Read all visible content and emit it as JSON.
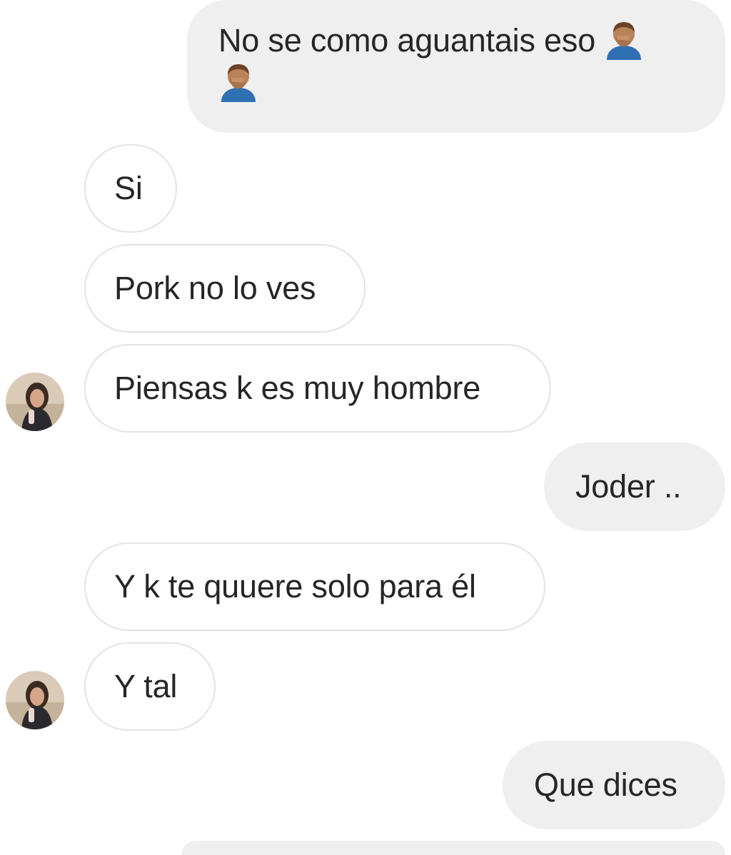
{
  "conversation": {
    "messages": [
      {
        "id": "m1",
        "direction": "outgoing",
        "text": "No se como aguantais eso",
        "emoji_after_text": "man-facepalming-icon",
        "emoji_second_line": "man-facepalming-icon"
      },
      {
        "id": "m2",
        "direction": "incoming",
        "text": "Si"
      },
      {
        "id": "m3",
        "direction": "incoming",
        "text": "Pork no lo ves"
      },
      {
        "id": "m4",
        "direction": "incoming",
        "text": "Piensas k es muy hombre",
        "avatar": "sender-avatar"
      },
      {
        "id": "m5",
        "direction": "outgoing",
        "text": "Joder .."
      },
      {
        "id": "m6",
        "direction": "incoming",
        "text": "Y k te quuere solo para él"
      },
      {
        "id": "m7",
        "direction": "incoming",
        "text": "Y tal",
        "avatar": "sender-avatar"
      },
      {
        "id": "m8",
        "direction": "outgoing",
        "text": "Que dices"
      }
    ]
  },
  "colors": {
    "incoming_bubble_bg": "#ffffff",
    "incoming_bubble_border": "#e3e3e3",
    "outgoing_bubble_bg": "#efefef",
    "text": "#262626"
  }
}
